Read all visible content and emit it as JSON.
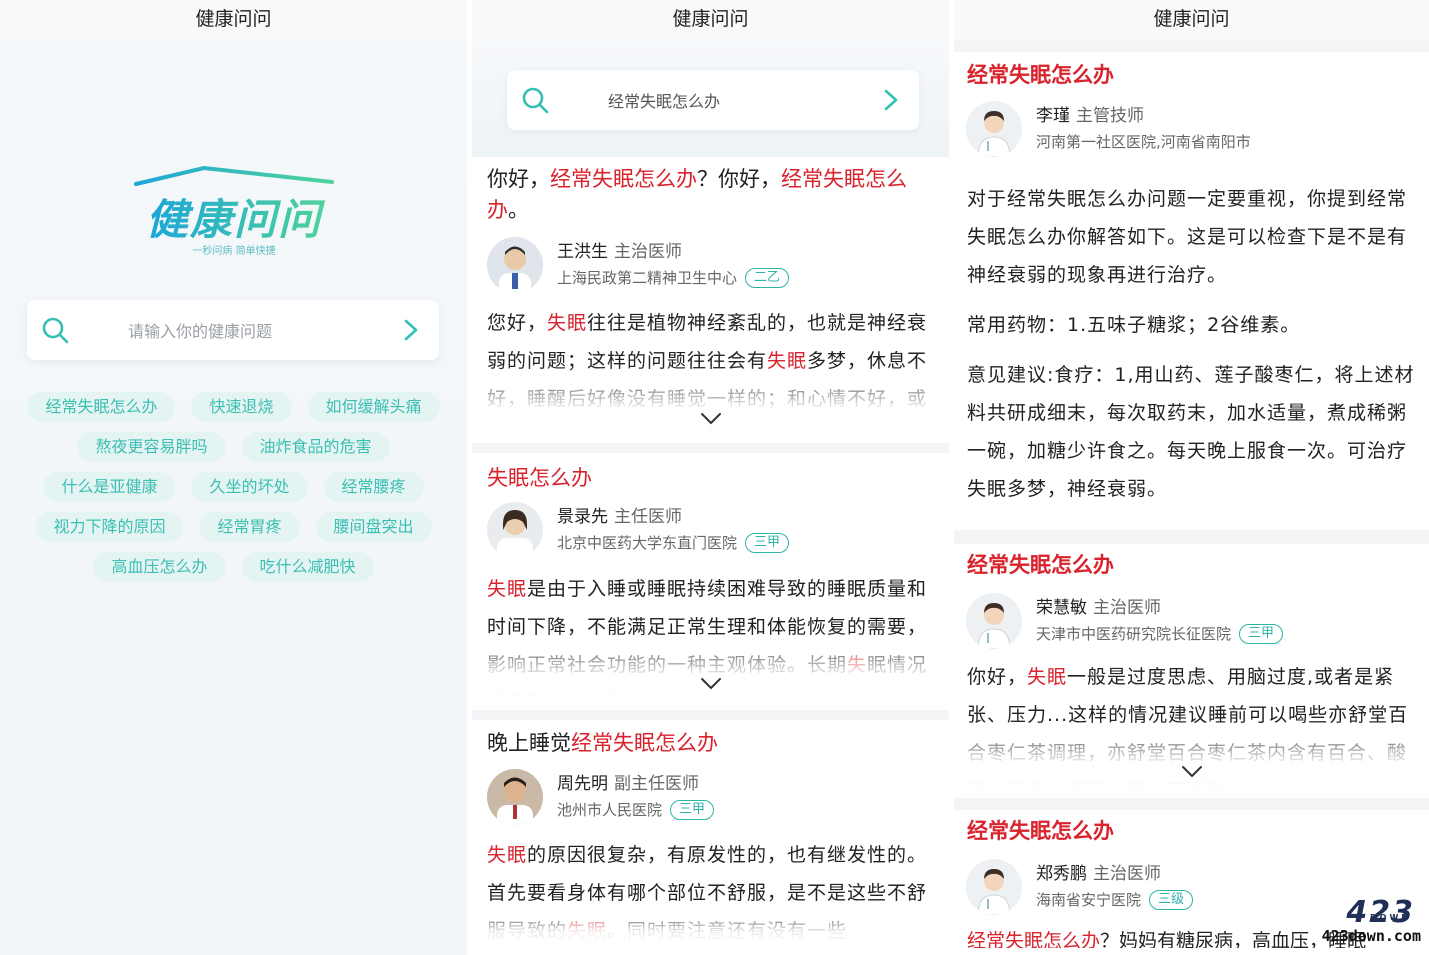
{
  "panel1": {
    "title": "健康问问",
    "logo_text": "健康问问",
    "logo_tagline": "一秒问病 简单快捷",
    "search_placeholder": "请输入你的健康问题",
    "tag_rows": [
      [
        "经常失眠怎么办",
        "快速退烧",
        "如何缓解头痛"
      ],
      [
        "熬夜更容易胖吗",
        "油炸食品的危害"
      ],
      [
        "什么是亚健康",
        "久坐的坏处",
        "经常腰疼"
      ],
      [
        "视力下降的原因",
        "经常胃疼",
        "腰间盘突出"
      ],
      [
        "高血压怎么办",
        "吃什么减肥快"
      ]
    ]
  },
  "panel2": {
    "title": "健康问问",
    "search_query": "经常失眠怎么办",
    "cards": [
      {
        "title_parts": [
          {
            "t": "你好，",
            "hl": false
          },
          {
            "t": "经常失眠怎么办",
            "hl": true
          },
          {
            "t": "？你好，",
            "hl": false
          },
          {
            "t": "经常失眠怎么办",
            "hl": true
          },
          {
            "t": "。",
            "hl": false
          }
        ],
        "doctor": "王洪生",
        "doctor_title": "主治医师",
        "hospital": "上海民政第二精神卫生中心",
        "badge": "二乙",
        "body_parts": [
          {
            "t": "您好，",
            "hl": false
          },
          {
            "t": "失眠",
            "hl": true
          },
          {
            "t": "往往是植物神经紊乱的，也就是神经衰弱的问题；这样的问题往往会有",
            "hl": false
          },
          {
            "t": "失眠",
            "hl": true
          },
          {
            "t": "多梦，休息不好，睡醒后好像没有睡觉一样的；和心情不好，或者比较着急有关系的，建议",
            "hl": false
          }
        ]
      },
      {
        "title_parts": [
          {
            "t": "失眠怎么办",
            "hl": true
          }
        ],
        "doctor": "景录先",
        "doctor_title": "主任医师",
        "hospital": "北京中医药大学东直门医院",
        "badge": "三甲",
        "body_parts": [
          {
            "t": "失眠",
            "hl": true
          },
          {
            "t": "是由于入睡或睡眠持续困难导致的睡眠质量和时间下降，不能满足正常生理和体能恢复的需要，影响正常社会功能的一种主观体验。长期",
            "hl": false
          },
          {
            "t": "失",
            "hl": true
          },
          {
            "t": "眠情况严重影响工作和身体健康，建议",
            "hl": false
          }
        ]
      },
      {
        "title_parts": [
          {
            "t": "晚上睡觉",
            "hl": false
          },
          {
            "t": "经常失眠怎么办",
            "hl": true
          }
        ],
        "doctor": "周先明",
        "doctor_title": "副主任医师",
        "hospital": "池州市人民医院",
        "badge": "三甲",
        "body_parts": [
          {
            "t": "失眠",
            "hl": true
          },
          {
            "t": "的原因很复杂，有原发性的，也有继发性的。首先要看身体有哪个部位不舒服，是不是这些不舒服导致的",
            "hl": false
          },
          {
            "t": "失眠",
            "hl": true
          },
          {
            "t": "。同时要注意还有没有一些",
            "hl": false
          }
        ]
      }
    ]
  },
  "panel3": {
    "title": "健康问问",
    "detail": {
      "title": "经常失眠怎么办",
      "doctor": "李瑾",
      "doctor_title": "主管技师",
      "hospital": "河南第一社区医院,河南省南阳市",
      "paragraphs": [
        "对于经常失眠怎么办问题一定要重视，你提到经常失眠怎么办你解答如下。这是可以检查下是不是有神经衰弱的现象再进行治疗。",
        "常用药物：1.五味子糖浆；2谷维素。",
        "意见建议:食疗：1,用山药、莲子酸枣仁，将上述材料共研成细末，每次取药末，加水适量，煮成稀粥一碗，加糖少许食之。每天晚上服食一次。可治疗失眠多梦，神经衰弱。"
      ]
    },
    "cards": [
      {
        "title": "经常失眠怎么办",
        "doctor": "荣慧敏",
        "doctor_title": "主治医师",
        "hospital": "天津市中医药研究院长征医院",
        "badge": "三甲",
        "body_parts": [
          {
            "t": "你好，",
            "hl": false
          },
          {
            "t": "失眠",
            "hl": true
          },
          {
            "t": "一般是过度思虑、用脑过度,或者是紧张、压力...这样的情况建议睡前可以喝些亦舒堂百合枣仁茶调理，亦舒堂百合枣仁茶内含有百合、酸枣、茯苓、莲子心等，可帮助",
            "hl": false
          }
        ]
      },
      {
        "title": "经常失眠怎么办",
        "doctor": "郑秀鹏",
        "doctor_title": "主治医师",
        "hospital": "海南省安宁医院",
        "badge": "三级",
        "snippet_parts": [
          {
            "t": "经常失眠怎么办",
            "hl": true
          },
          {
            "t": "？妈妈有糖尿病，高血压，睡眠",
            "hl": false
          }
        ]
      }
    ]
  },
  "watermark": {
    "main": "423",
    "sub": "DOWN",
    "site": "423down.com"
  }
}
